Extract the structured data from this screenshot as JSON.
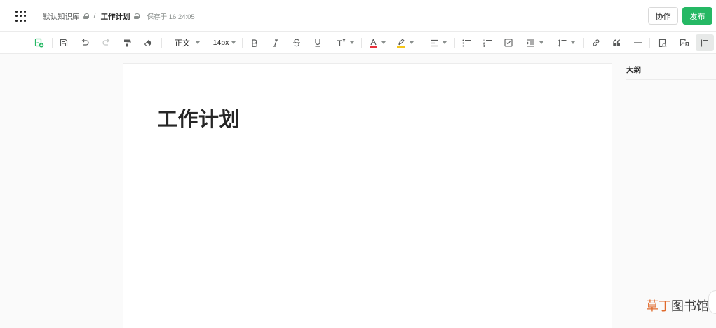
{
  "header": {
    "knowledge_base": "默认知识库",
    "separator": "/",
    "document": "工作计划",
    "saved_status": "保存于 16:24:05",
    "collab_label": "协作",
    "publish_label": "发布"
  },
  "toolbar": {
    "paragraph_style": "正文",
    "font_size": "14px"
  },
  "document": {
    "title": "工作计划"
  },
  "outline": {
    "title": "大纲"
  },
  "watermark": {
    "part1": "草丁",
    "part2": "图书馆"
  },
  "colors": {
    "accent_green": "#25b864",
    "font_color_marker": "#e8323c",
    "highlight_marker": "#f5c518"
  },
  "icons": [
    "apps-grid-icon",
    "lock-icon",
    "add-doc-icon",
    "save-icon",
    "undo-icon",
    "redo-icon",
    "format-painter-icon",
    "eraser-icon",
    "bold-icon",
    "italic-icon",
    "strikethrough-icon",
    "underline-icon",
    "superscript-icon",
    "font-color-icon",
    "highlight-icon",
    "align-left-icon",
    "bullet-list-icon",
    "ordered-list-icon",
    "task-list-icon",
    "indent-icon",
    "line-height-icon",
    "link-icon",
    "quote-icon",
    "divider-icon",
    "search-doc-icon",
    "insert-image-icon",
    "outline-toggle-icon"
  ]
}
